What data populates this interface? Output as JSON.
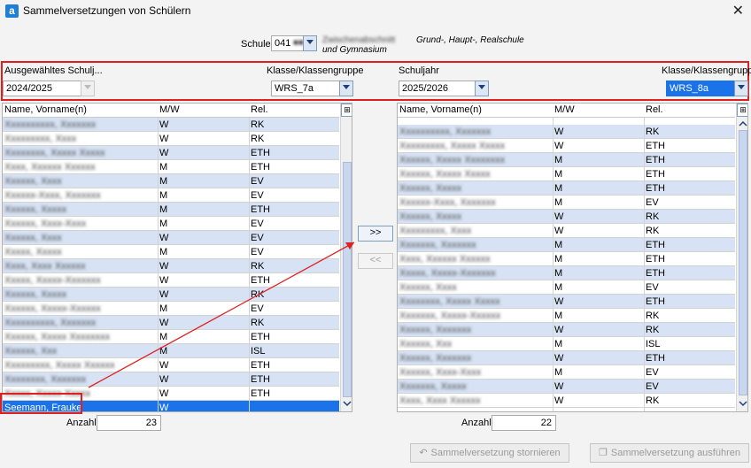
{
  "window": {
    "title": "Sammelversetzungen von Schülern",
    "app_icon": "a"
  },
  "school": {
    "label": "Schule",
    "code": "041",
    "name_blurred": "Zwischenabschnitt",
    "name_suffix_line1": "Grund-, Haupt-, Realschule",
    "name_suffix_line2": "und Gymnasium"
  },
  "source": {
    "year_label": "Ausgewähltes Schulj...",
    "year_value": "2024/2025",
    "class_label": "Klasse/Klassengruppe",
    "class_value": "WRS_7a"
  },
  "target": {
    "year_label": "Schuljahr",
    "year_value": "2025/2026",
    "class_label": "Klasse/Klassengruppe",
    "class_value": "WRS_8a"
  },
  "columns": {
    "name": "Name, Vorname(n)",
    "mw": "M/W",
    "rel": "Rel."
  },
  "left_list": [
    {
      "name": "Xxxxxxxxxx, Xxxxxxx",
      "mw": "W",
      "rel": "RK"
    },
    {
      "name": "Xxxxxxxxx, Xxxx",
      "mw": "W",
      "rel": "RK"
    },
    {
      "name": "Xxxxxxxx, Xxxxx Xxxxx",
      "mw": "W",
      "rel": "ETH"
    },
    {
      "name": "Xxxx, Xxxxxx Xxxxxx",
      "mw": "M",
      "rel": "ETH"
    },
    {
      "name": "Xxxxxx, Xxxx",
      "mw": "M",
      "rel": "EV"
    },
    {
      "name": "Xxxxxx-Xxxx, Xxxxxxx",
      "mw": "M",
      "rel": "EV"
    },
    {
      "name": "Xxxxxx, Xxxxx",
      "mw": "M",
      "rel": "ETH"
    },
    {
      "name": "Xxxxxx, Xxxx-Xxxx",
      "mw": "M",
      "rel": "EV"
    },
    {
      "name": "Xxxxxx, Xxxx",
      "mw": "W",
      "rel": "EV"
    },
    {
      "name": "Xxxxx, Xxxxx",
      "mw": "M",
      "rel": "EV"
    },
    {
      "name": "Xxxx, Xxxx Xxxxxx",
      "mw": "W",
      "rel": "RK"
    },
    {
      "name": "Xxxxx, Xxxxx-Xxxxxxx",
      "mw": "W",
      "rel": "ETH"
    },
    {
      "name": "Xxxxxx, Xxxxx",
      "mw": "W",
      "rel": "RK"
    },
    {
      "name": "Xxxxxx, Xxxxx-Xxxxxx",
      "mw": "M",
      "rel": "EV"
    },
    {
      "name": "Xxxxxxxxxx, Xxxxxxx",
      "mw": "W",
      "rel": "RK"
    },
    {
      "name": "Xxxxxx, Xxxxx Xxxxxxxx",
      "mw": "M",
      "rel": "ETH"
    },
    {
      "name": "Xxxxxx, Xxx",
      "mw": "M",
      "rel": "ISL"
    },
    {
      "name": "Xxxxxxxxx, Xxxxx Xxxxxx",
      "mw": "W",
      "rel": "ETH"
    },
    {
      "name": "Xxxxxxxx, Xxxxxxx",
      "mw": "W",
      "rel": "ETH"
    },
    {
      "name": "Xxxxx, Xxxxx Xxxxx",
      "mw": "W",
      "rel": "ETH"
    },
    {
      "name": "Seemann, Frauke",
      "mw": "W",
      "rel": ""
    }
  ],
  "right_list": [
    {
      "name": "Xxxxxxxxxx, Xxxxxxx",
      "mw": "W",
      "rel": "RK"
    },
    {
      "name": "Xxxxxxxxx, Xxxxx Xxxxx",
      "mw": "W",
      "rel": "ETH"
    },
    {
      "name": "Xxxxxx, Xxxxx Xxxxxxxx",
      "mw": "M",
      "rel": "ETH"
    },
    {
      "name": "Xxxxxx, Xxxxx Xxxxx",
      "mw": "M",
      "rel": "ETH"
    },
    {
      "name": "Xxxxxx, Xxxxx",
      "mw": "M",
      "rel": "ETH"
    },
    {
      "name": "Xxxxxx-Xxxx, Xxxxxxx",
      "mw": "M",
      "rel": "EV"
    },
    {
      "name": "Xxxxxx, Xxxxx",
      "mw": "W",
      "rel": "RK"
    },
    {
      "name": "Xxxxxxxxx, Xxxx",
      "mw": "W",
      "rel": "RK"
    },
    {
      "name": "Xxxxxxx, Xxxxxxx",
      "mw": "M",
      "rel": "ETH"
    },
    {
      "name": "Xxxx, Xxxxxx Xxxxxx",
      "mw": "M",
      "rel": "ETH"
    },
    {
      "name": "Xxxxx, Xxxxx-Xxxxxxx",
      "mw": "M",
      "rel": "ETH"
    },
    {
      "name": "Xxxxxx, Xxxx",
      "mw": "M",
      "rel": "EV"
    },
    {
      "name": "Xxxxxxxx, Xxxxx Xxxxx",
      "mw": "W",
      "rel": "ETH"
    },
    {
      "name": "Xxxxxxx, Xxxxx-Xxxxxx",
      "mw": "M",
      "rel": "RK"
    },
    {
      "name": "Xxxxxx, Xxxxxxx",
      "mw": "W",
      "rel": "RK"
    },
    {
      "name": "Xxxxxx, Xxx",
      "mw": "M",
      "rel": "ISL"
    },
    {
      "name": "Xxxxxx, Xxxxxxx",
      "mw": "W",
      "rel": "ETH"
    },
    {
      "name": "Xxxxxx, Xxxx-Xxxx",
      "mw": "M",
      "rel": "EV"
    },
    {
      "name": "Xxxxxxx, Xxxxx",
      "mw": "W",
      "rel": "EV"
    },
    {
      "name": "Xxxx, Xxxx Xxxxxx",
      "mw": "W",
      "rel": "RK"
    }
  ],
  "selected_row_index": 20,
  "buttons": {
    "move_right": ">>",
    "move_left": "<<",
    "cancel": "Sammelversetzung stornieren",
    "execute": "Sammelversetzung ausführen"
  },
  "counts": {
    "label": "Anzahl",
    "left": "23",
    "right": "22"
  },
  "colors": {
    "accent": "#1a73e8",
    "highlight": "#e02020",
    "alt_row": "#d7e3f5"
  }
}
